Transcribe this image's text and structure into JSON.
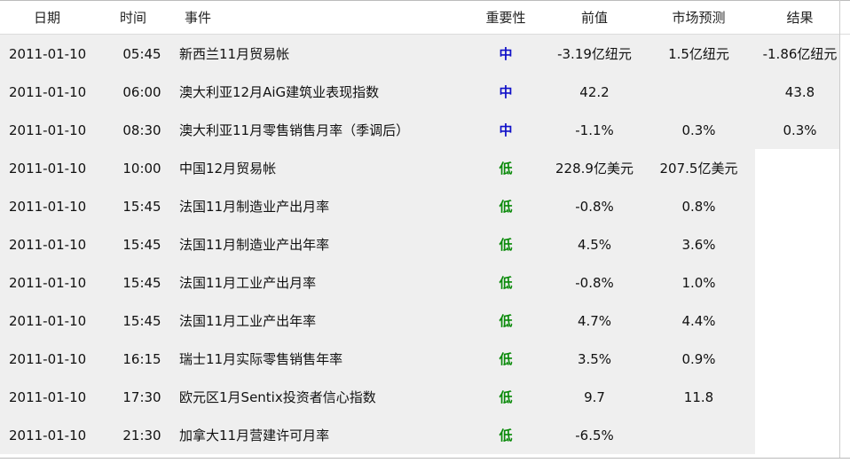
{
  "headers": {
    "date": "日期",
    "time": "时间",
    "event": "事件",
    "importance": "重要性",
    "previous": "前值",
    "forecast": "市场预测",
    "result": "结果"
  },
  "colors": {
    "importance_medium": "#1010c8",
    "importance_low": "#0a8a0a",
    "row_shade": "#efefef"
  },
  "rows": [
    {
      "date": "2011-01-10",
      "time": "05:45",
      "event": "新西兰11月贸易帐",
      "importance": "中",
      "level": "medium",
      "previous": "-3.19亿纽元",
      "forecast": "1.5亿纽元",
      "result": "-1.86亿纽元",
      "shade_full": true
    },
    {
      "date": "2011-01-10",
      "time": "06:00",
      "event": "澳大利亚12月AiG建筑业表现指数",
      "importance": "中",
      "level": "medium",
      "previous": "42.2",
      "forecast": "",
      "result": "43.8",
      "shade_full": true
    },
    {
      "date": "2011-01-10",
      "time": "08:30",
      "event": "澳大利亚11月零售销售月率（季调后）",
      "importance": "中",
      "level": "medium",
      "previous": "-1.1%",
      "forecast": "0.3%",
      "result": "0.3%",
      "shade_full": true
    },
    {
      "date": "2011-01-10",
      "time": "10:00",
      "event": "中国12月贸易帐",
      "importance": "低",
      "level": "low",
      "previous": "228.9亿美元",
      "forecast": "207.5亿美元",
      "result": "",
      "shade_full": false
    },
    {
      "date": "2011-01-10",
      "time": "15:45",
      "event": "法国11月制造业产出月率",
      "importance": "低",
      "level": "low",
      "previous": "-0.8%",
      "forecast": "0.8%",
      "result": "",
      "shade_full": false
    },
    {
      "date": "2011-01-10",
      "time": "15:45",
      "event": "法国11月制造业产出年率",
      "importance": "低",
      "level": "low",
      "previous": "4.5%",
      "forecast": "3.6%",
      "result": "",
      "shade_full": false
    },
    {
      "date": "2011-01-10",
      "time": "15:45",
      "event": "法国11月工业产出月率",
      "importance": "低",
      "level": "low",
      "previous": "-0.8%",
      "forecast": "1.0%",
      "result": "",
      "shade_full": false
    },
    {
      "date": "2011-01-10",
      "time": "15:45",
      "event": "法国11月工业产出年率",
      "importance": "低",
      "level": "low",
      "previous": "4.7%",
      "forecast": "4.4%",
      "result": "",
      "shade_full": false
    },
    {
      "date": "2011-01-10",
      "time": "16:15",
      "event": "瑞士11月实际零售销售年率",
      "importance": "低",
      "level": "low",
      "previous": "3.5%",
      "forecast": "0.9%",
      "result": "",
      "shade_full": false
    },
    {
      "date": "2011-01-10",
      "time": "17:30",
      "event": "欧元区1月Sentix投资者信心指数",
      "importance": "低",
      "level": "low",
      "previous": "9.7",
      "forecast": "11.8",
      "result": "",
      "shade_full": false
    },
    {
      "date": "2011-01-10",
      "time": "21:30",
      "event": "加拿大11月营建许可月率",
      "importance": "低",
      "level": "low",
      "previous": "-6.5%",
      "forecast": "",
      "result": "",
      "shade_full": false
    }
  ]
}
